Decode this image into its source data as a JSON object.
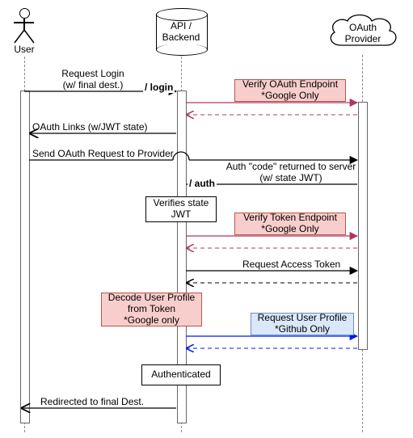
{
  "participants": {
    "user": "User",
    "backend": "API /\nBackend",
    "provider": "OAuth\nProvider"
  },
  "endpoints": {
    "login": "/ login",
    "auth": "/ auth"
  },
  "messages": {
    "m1": "Request Login\n(w/ final dest.)",
    "m2": "Verify OAuth Endpoint\n*Google Only",
    "m3": "OAuth Links (w/JWT state)",
    "m4": "Send OAuth Request to Provider",
    "m5": "Auth \"code\" returned to server\n(w/ state JWT)",
    "m6": "Verifies state\nJWT",
    "m7": "Verify Token Endpoint\n*Google Only",
    "m8": "Request Access Token",
    "m9": "Decode User Profile\nfrom Token\n*Google only",
    "m10": "Request User Profile\n*Github Only",
    "m11": "Authenticated",
    "m12": "Redirected to final Dest."
  },
  "chart_data": {
    "type": "sequence-diagram",
    "participants": [
      "User",
      "API / Backend",
      "OAuth Provider"
    ],
    "lifeline_x": {
      "User": 30,
      "API / Backend": 224,
      "OAuth Provider": 448
    },
    "steps": [
      {
        "from": "User",
        "to": "API / Backend",
        "label": "Request Login (w/ final dest.)",
        "endpoint": "/ login",
        "style": "solid"
      },
      {
        "from": "API / Backend",
        "to": "OAuth Provider",
        "label": "Verify OAuth Endpoint *Google Only",
        "style": "solid",
        "color": "crimson",
        "tag": "google"
      },
      {
        "from": "OAuth Provider",
        "to": "API / Backend",
        "label": "",
        "style": "dashed",
        "color": "crimson",
        "tag": "google"
      },
      {
        "from": "API / Backend",
        "to": "User",
        "label": "OAuth Links (w/JWT state)",
        "style": "solid-open"
      },
      {
        "from": "User",
        "to": "OAuth Provider",
        "label": "Send OAuth Request to Provider",
        "style": "solid",
        "passes_over": [
          "API / Backend"
        ]
      },
      {
        "from": "OAuth Provider",
        "to": "API / Backend",
        "label": "Auth \"code\" returned to server (w/ state JWT)",
        "endpoint": "/ auth",
        "style": "solid"
      },
      {
        "self": "API / Backend",
        "label": "Verifies state JWT",
        "kind": "note"
      },
      {
        "from": "API / Backend",
        "to": "OAuth Provider",
        "label": "Verify Token Endpoint *Google Only",
        "style": "solid",
        "color": "crimson",
        "tag": "google"
      },
      {
        "from": "OAuth Provider",
        "to": "API / Backend",
        "label": "",
        "style": "dashed",
        "color": "crimson",
        "tag": "google"
      },
      {
        "from": "API / Backend",
        "to": "OAuth Provider",
        "label": "Request Access Token",
        "style": "solid"
      },
      {
        "from": "OAuth Provider",
        "to": "API / Backend",
        "label": "",
        "style": "dashed"
      },
      {
        "self": "API / Backend",
        "label": "Decode User Profile from Token *Google only",
        "kind": "note",
        "tag": "google"
      },
      {
        "from": "API / Backend",
        "to": "OAuth Provider",
        "label": "Request User Profile *Github Only",
        "style": "solid",
        "color": "blue",
        "tag": "github"
      },
      {
        "from": "OAuth Provider",
        "to": "API / Backend",
        "label": "",
        "style": "dashed",
        "color": "blue",
        "tag": "github"
      },
      {
        "self": "API / Backend",
        "label": "Authenticated",
        "kind": "note"
      },
      {
        "from": "API / Backend",
        "to": "User",
        "label": "Redirected to final Dest.",
        "style": "solid-open"
      }
    ]
  }
}
